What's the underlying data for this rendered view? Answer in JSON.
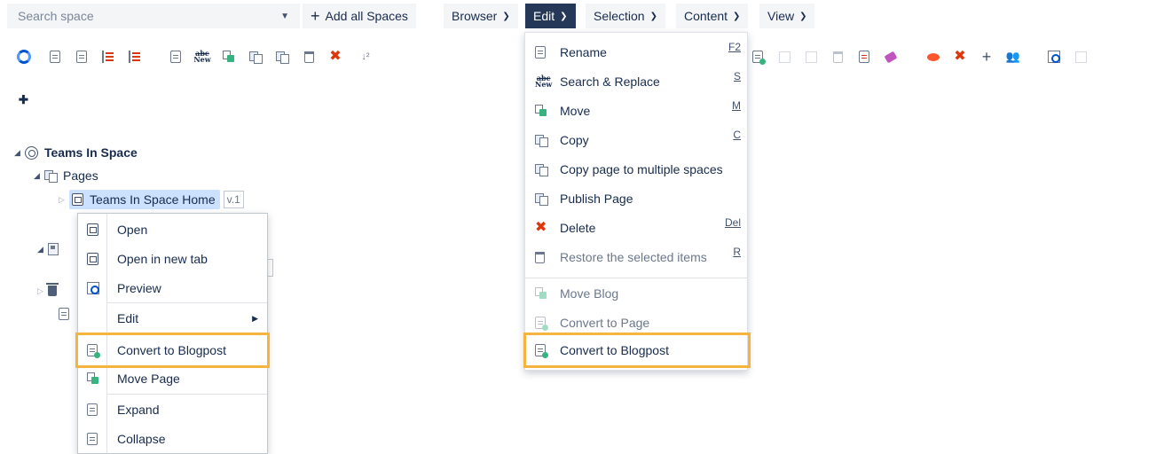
{
  "top_bar": {
    "search_placeholder": "Search space",
    "add_all_spaces_label": "Add all Spaces",
    "menus": [
      {
        "label": "Browser"
      },
      {
        "label": "Edit"
      },
      {
        "label": "Selection"
      },
      {
        "label": "Content"
      },
      {
        "label": "View"
      }
    ]
  },
  "toolbar": {
    "new_icon_text": "New"
  },
  "tree": {
    "space_name": "Teams In Space",
    "pages_label": "Pages",
    "home_page": "Teams In Space Home",
    "home_version": "v.1"
  },
  "context_menu": {
    "items": [
      {
        "label": "Open"
      },
      {
        "label": "Open in new tab"
      },
      {
        "label": "Preview"
      },
      {
        "label": "Edit"
      },
      {
        "label": "Convert to Blogpost"
      },
      {
        "label": "Move Page"
      },
      {
        "label": "Expand"
      },
      {
        "label": "Collapse"
      }
    ]
  },
  "edit_menu": {
    "items": [
      {
        "label": "Rename",
        "shortcut": "F2"
      },
      {
        "label": "Search & Replace",
        "shortcut": "S"
      },
      {
        "label": "Move",
        "shortcut": "M"
      },
      {
        "label": "Copy",
        "shortcut": "C"
      },
      {
        "label": "Copy page to multiple spaces"
      },
      {
        "label": "Publish Page"
      },
      {
        "label": "Delete",
        "shortcut": "Del"
      },
      {
        "label": "Restore the selected items",
        "shortcut": "R"
      },
      {
        "label": "Move Blog"
      },
      {
        "label": "Convert to Page"
      },
      {
        "label": "Convert to Blogpost"
      }
    ]
  },
  "colors": {
    "active_menu_bg": "#253858",
    "highlight_outline": "#f5b43d",
    "selected_node_bg": "#cce0ff",
    "delete_red": "#de350b"
  }
}
